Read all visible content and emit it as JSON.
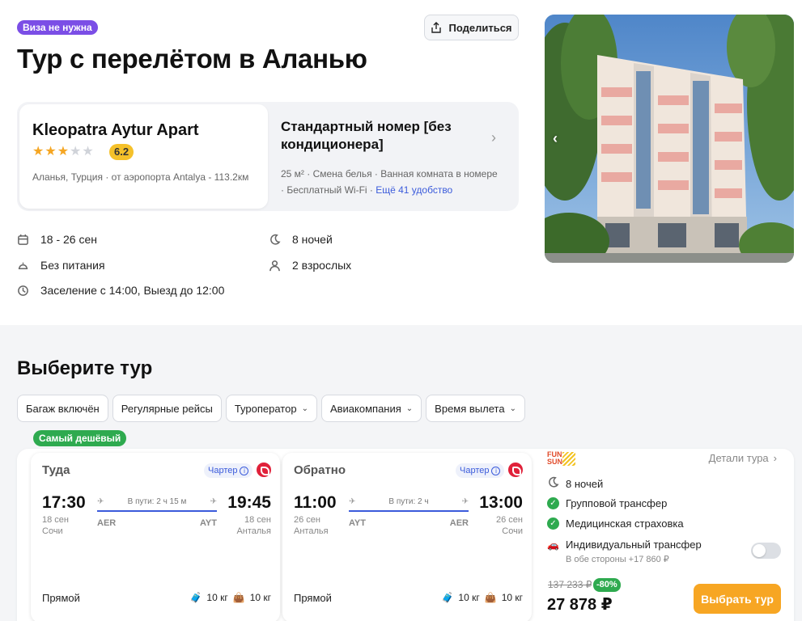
{
  "header": {
    "visa_badge": "Виза не нужна",
    "share_label": "Поделиться",
    "title": "Тур с перелётом в Аланью"
  },
  "hotel": {
    "name": "Kleopatra Aytur Apart",
    "stars": 3,
    "rating": "6.2",
    "location": "Аланья, Турция · от аэропорта Antalya - 113.2км"
  },
  "room": {
    "name": "Стандартный номер [без кондиционера]",
    "features_line1": "25 м² · Смена белья · Ванная комната в номере",
    "features_line2": "· Бесплатный Wi-Fi ·",
    "more_link": "Ещё 41 удобство"
  },
  "trip": {
    "dates": "18 - 26 сен",
    "nights": "8 ночей",
    "meals": "Без питания",
    "guests": "2 взрослых",
    "checkin": "Заселение с 14:00, Выезд до 12:00"
  },
  "choose": {
    "title": "Выберите тур",
    "filters": [
      "Багаж включён",
      "Регулярные рейсы",
      "Туроператор",
      "Авиакомпания",
      "Время вылета"
    ]
  },
  "tour": {
    "badge": "Самый дешёвый",
    "outbound": {
      "direction": "Туда",
      "charter": "Чартер",
      "dep_time": "17:30",
      "dep_date": "18 сен",
      "dep_city": "Сочи",
      "duration": "В пути: 2 ч 15 м",
      "dep_code": "AER",
      "arr_code": "AYT",
      "arr_time": "19:45",
      "arr_date": "18 сен",
      "arr_city": "Анталья",
      "stops": "Прямой",
      "bag1": "10 кг",
      "bag2": "10 кг"
    },
    "return": {
      "direction": "Обратно",
      "charter": "Чартер",
      "dep_time": "11:00",
      "dep_date": "26 сен",
      "dep_city": "Анталья",
      "duration": "В пути: 2 ч",
      "dep_code": "AYT",
      "arr_code": "AER",
      "arr_time": "13:00",
      "arr_date": "26 сен",
      "arr_city": "Сочи",
      "stops": "Прямой",
      "bag1": "10 кг",
      "bag2": "10 кг"
    },
    "operator_logo_line1": "FUN",
    "operator_logo_line2": "SUN",
    "details_link": "Детали тура",
    "nights": "8 ночей",
    "group_transfer": "Групповой трансфер",
    "insurance": "Медицинская страховка",
    "individual_transfer": "Индивидуальный трансфер",
    "individual_transfer_price": "В обе стороны +17 860 ₽",
    "old_price": "137 233 ₽",
    "discount": "-80%",
    "price": "27 878 ₽",
    "cta": "Выбрать тур"
  },
  "colors": {
    "accent_purple": "#7b4ee6",
    "accent_blue": "#3b5bdb",
    "success_green": "#2eaa4f",
    "cta_orange": "#f7a623",
    "rating_yellow": "#f5c12a"
  }
}
